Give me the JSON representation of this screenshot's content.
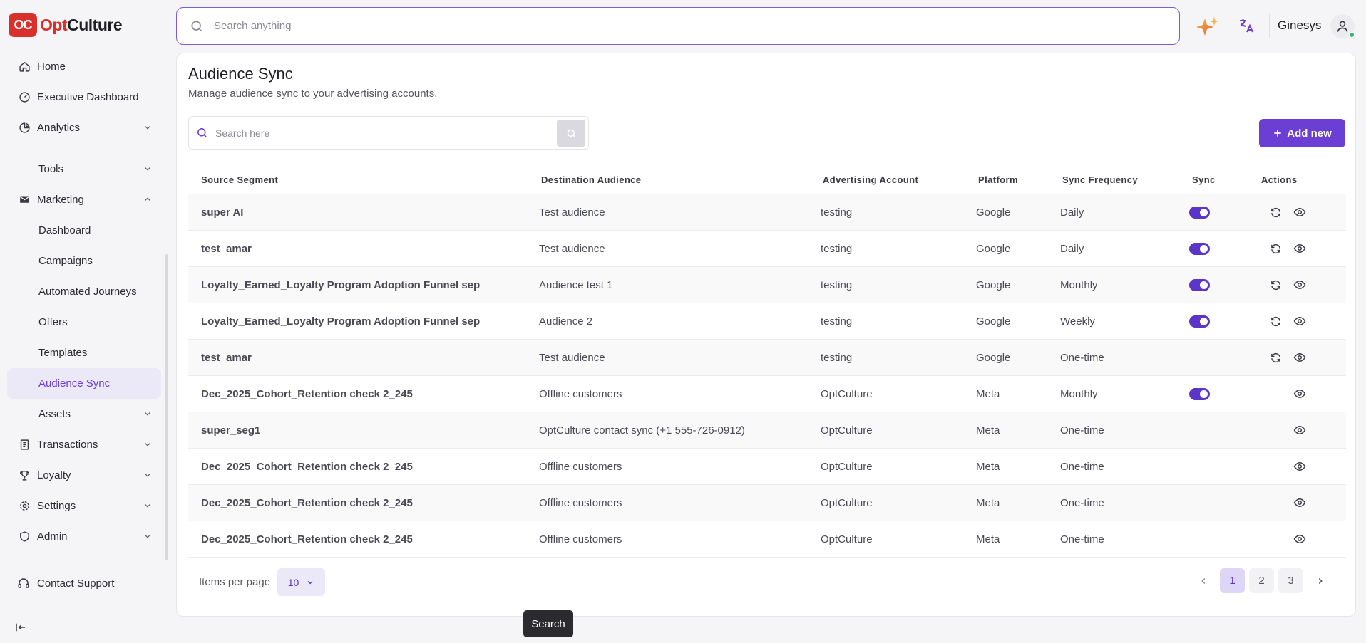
{
  "brand": {
    "logo_mark": "OC",
    "name_prefix": "Opt",
    "name_suffix": "Culture",
    "accent": "#6b3fd4",
    "logo_color": "#d8312b"
  },
  "topbar": {
    "search_placeholder": "Search anything",
    "org_name": "Ginesys"
  },
  "sidebar": {
    "items": [
      {
        "label": "Home",
        "icon": "home-icon"
      },
      {
        "label": "Executive Dashboard",
        "icon": "dashboard-gauge-icon"
      },
      {
        "label": "Analytics",
        "icon": "analytics-icon"
      },
      {
        "label": "Tools"
      },
      {
        "label": "Marketing",
        "icon": "envelope-icon"
      },
      {
        "label": "Dashboard"
      },
      {
        "label": "Campaigns"
      },
      {
        "label": "Automated Journeys"
      },
      {
        "label": "Offers"
      },
      {
        "label": "Templates"
      },
      {
        "label": "Audience Sync"
      },
      {
        "label": "Assets"
      },
      {
        "label": "Transactions",
        "icon": "receipt-icon"
      },
      {
        "label": "Loyalty",
        "icon": "trophy-icon"
      },
      {
        "label": "Settings",
        "icon": "gear-icon"
      },
      {
        "label": "Admin",
        "icon": "shield-icon"
      }
    ],
    "support_label": "Contact Support"
  },
  "page": {
    "title": "Audience Sync",
    "subtitle": "Manage audience sync to your advertising accounts.",
    "search_placeholder": "Search here",
    "add_label": "Add new"
  },
  "table": {
    "columns": [
      "Source Segment",
      "Destination Audience",
      "Advertising Account",
      "Platform",
      "Sync Frequency",
      "Sync",
      "Actions"
    ],
    "rows": [
      {
        "segment": "super AI",
        "audience": "Test audience",
        "account": "testing",
        "platform": "Google",
        "frequency": "Daily",
        "sync": true,
        "resync": true
      },
      {
        "segment": "test_amar",
        "audience": "Test audience",
        "account": "testing",
        "platform": "Google",
        "frequency": "Daily",
        "sync": true,
        "resync": true
      },
      {
        "segment": "Loyalty_Earned_Loyalty Program Adoption Funnel sep",
        "audience": "Audience test 1",
        "account": "testing",
        "platform": "Google",
        "frequency": "Monthly",
        "sync": true,
        "resync": true
      },
      {
        "segment": "Loyalty_Earned_Loyalty Program Adoption Funnel sep",
        "audience": "Audience 2",
        "account": "testing",
        "platform": "Google",
        "frequency": "Weekly",
        "sync": true,
        "resync": true
      },
      {
        "segment": "test_amar",
        "audience": "Test audience",
        "account": "testing",
        "platform": "Google",
        "frequency": "One-time",
        "sync": false,
        "resync": true
      },
      {
        "segment": "Dec_2025_Cohort_Retention check 2_245",
        "audience": "Offline customers",
        "account": "OptCulture",
        "platform": "Meta",
        "frequency": "Monthly",
        "sync": true,
        "resync": false
      },
      {
        "segment": "super_seg1",
        "audience": "OptCulture contact sync (+1 555-726-0912)",
        "account": "OptCulture",
        "platform": "Meta",
        "frequency": "One-time",
        "sync": false,
        "resync": false
      },
      {
        "segment": "Dec_2025_Cohort_Retention check 2_245",
        "audience": "Offline customers",
        "account": "OptCulture",
        "platform": "Meta",
        "frequency": "One-time",
        "sync": false,
        "resync": false
      },
      {
        "segment": "Dec_2025_Cohort_Retention check 2_245",
        "audience": "Offline customers",
        "account": "OptCulture",
        "platform": "Meta",
        "frequency": "One-time",
        "sync": false,
        "resync": false
      },
      {
        "segment": "Dec_2025_Cohort_Retention check 2_245",
        "audience": "Offline customers",
        "account": "OptCulture",
        "platform": "Meta",
        "frequency": "One-time",
        "sync": false,
        "resync": false
      }
    ]
  },
  "pagination": {
    "items_per_page_label": "Items per page",
    "items_per_page": "10",
    "pages": [
      "1",
      "2",
      "3"
    ],
    "current": "1"
  },
  "tooltip": {
    "text": "Search"
  }
}
